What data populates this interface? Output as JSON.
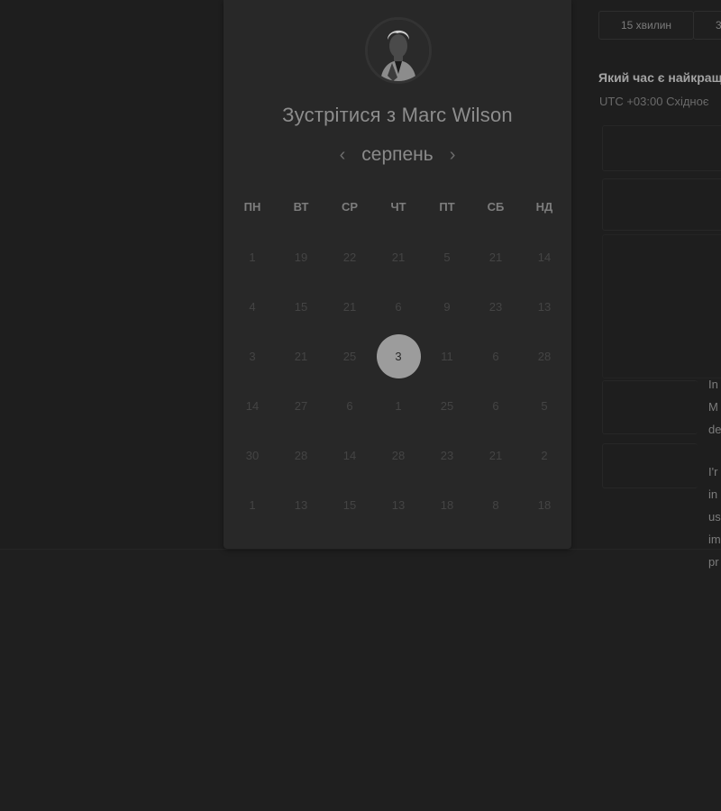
{
  "header": {
    "title_prefix": "Зустрітися з",
    "host_name": "Marc Wilson"
  },
  "calendar": {
    "month": "серпень",
    "prev_icon": "chevron-left-icon",
    "next_icon": "chevron-right-icon",
    "weekdays": [
      "ПН",
      "ВТ",
      "СР",
      "ЧТ",
      "ПТ",
      "СБ",
      "НД"
    ],
    "weeks": [
      [
        "1",
        "19",
        "22",
        "21",
        "5",
        "21",
        "14"
      ],
      [
        "4",
        "15",
        "21",
        "6",
        "9",
        "23",
        "13"
      ],
      [
        "3",
        "21",
        "25",
        "3",
        "11",
        "6",
        "28"
      ],
      [
        "14",
        "27",
        "6",
        "1",
        "25",
        "6",
        "5"
      ],
      [
        "30",
        "28",
        "14",
        "28",
        "23",
        "21",
        "2"
      ],
      [
        "1",
        "13",
        "15",
        "13",
        "18",
        "8",
        "18"
      ]
    ],
    "selected": {
      "week": 2,
      "day": 3
    }
  },
  "panel": {
    "duration_tabs": [
      "15 хвилин",
      "3"
    ],
    "question": "Який час є найкращ",
    "timezone": "UTC +03:00 Східноє",
    "bio_fragments": [
      [
        "In",
        "M",
        "de"
      ],
      [
        "I'r",
        "in",
        "us",
        "im",
        "pr"
      ]
    ]
  },
  "colors": {
    "background": "#1f1f1f",
    "card": "#282828",
    "selected_day": "#9c9c9c"
  }
}
